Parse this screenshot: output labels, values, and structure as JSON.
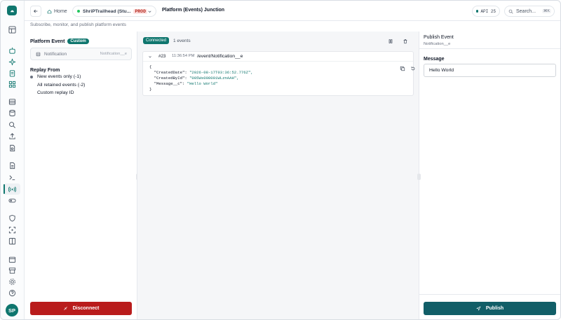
{
  "topbar": {
    "back_label": "←",
    "home_label": "Home",
    "org_name": "ShriPTrailhead (Stu...",
    "org_env_tag": "PROD",
    "page_title": "Platform (Events) Junction",
    "api_label": "API 25",
    "search_placeholder": "Search...",
    "search_shortcut": "⌘K"
  },
  "subtitle": "Subscribe, monitor, and publish platform events",
  "left_panel": {
    "platform_event_label": "Platform Event",
    "custom_badge": "Custom",
    "selected_event_label": "Notification",
    "selected_event_api": "Notification__e",
    "replay_label": "Replay From",
    "replay_options": [
      {
        "label": "New events only (-1)",
        "selected": true
      },
      {
        "label": "All retained events (-2)",
        "selected": false
      },
      {
        "label": "Custom replay ID",
        "selected": false
      }
    ],
    "disconnect_label": "Disconnect"
  },
  "center_panel": {
    "status_badge": "Connected",
    "event_count": "1 events",
    "event": {
      "number": "#23",
      "time": "11:36:54 PM",
      "channel": "/event/Notification__e",
      "payload_lines": [
        {
          "key": "",
          "value": "{"
        },
        {
          "key": "  \"CreatedDate\": ",
          "value": "\"2026-08-17T03:36:52.776Z\","
        },
        {
          "key": "  \"CreatedById\": ",
          "value": "\"005Ws000001WLznAAH\","
        },
        {
          "key": "  \"Message__c\": ",
          "value": "\"Hello World\""
        },
        {
          "key": "",
          "value": "}"
        }
      ]
    }
  },
  "right_panel": {
    "title": "Publish Event",
    "event_api": "Notification__e",
    "message_label": "Message",
    "message_value": "Hello World",
    "publish_label": "Publish"
  },
  "user": {
    "initials": "SP"
  },
  "colors": {
    "accent": "#0f766e",
    "danger": "#b91c1c",
    "publish": "#115e67"
  }
}
